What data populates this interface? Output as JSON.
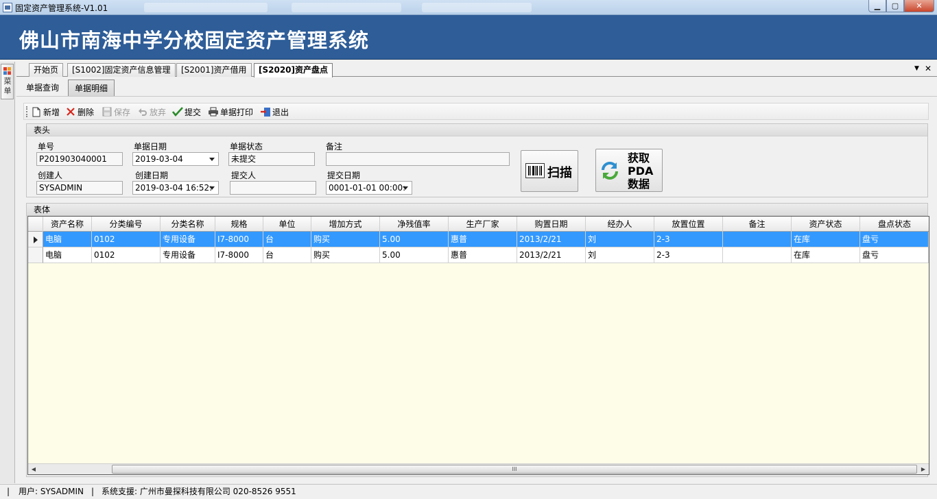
{
  "window": {
    "title": "固定资产管理系统-V1.01",
    "controls": {
      "minimize": "▁",
      "maximize": "▢",
      "close": "✕"
    }
  },
  "banner": {
    "title": "佛山市南海中学分校固定资产管理系统"
  },
  "left_menu": {
    "label": "菜单",
    "icon": "menu-grid-icon"
  },
  "doc_tabs": [
    {
      "label": "开始页"
    },
    {
      "label": "[S1002]固定资产信息管理"
    },
    {
      "label": "[S2001]资产借用"
    },
    {
      "label": "[S2020]资产盘点",
      "active": true
    }
  ],
  "tab_controls": {
    "dropdown": "▼",
    "close": "✕"
  },
  "sub_tabs": [
    {
      "label": "单据查询"
    },
    {
      "label": "单据明细",
      "active": true
    }
  ],
  "toolbar": {
    "new": "新增",
    "delete": "删除",
    "save": "保存",
    "discard": "放弃",
    "submit": "提交",
    "print": "单据打印",
    "exit": "退出"
  },
  "header_section": {
    "title": "表头",
    "doc_no_label": "单号",
    "doc_no": "P201903040001",
    "doc_date_label": "单据日期",
    "doc_date": "2019-03-04",
    "doc_status_label": "单据状态",
    "doc_status": "未提交",
    "remark_label": "备注",
    "remark": "",
    "creator_label": "创建人",
    "creator": "SYSADMIN",
    "create_date_label": "创建日期",
    "create_date": "2019-03-04 16:52:",
    "submitter_label": "提交人",
    "submitter": "",
    "submit_date_label": "提交日期",
    "submit_date": "0001-01-01 00:00:",
    "scan_button": "扫描",
    "pda_button_line1": "获取",
    "pda_button_line2": "PDA",
    "pda_button_line3": "数据"
  },
  "body_section": {
    "title": "表体",
    "columns": [
      "资产名称",
      "分类编号",
      "分类名称",
      "规格",
      "单位",
      "增加方式",
      "净残值率",
      "生产厂家",
      "购置日期",
      "经办人",
      "放置位置",
      "备注",
      "资产状态",
      "盘点状态"
    ],
    "rows": [
      [
        "电脑",
        "0102",
        "专用设备",
        "I7-8000",
        "台",
        "购买",
        "5.00",
        "惠普",
        "2013/2/21",
        "刘",
        "2-3",
        "",
        "在库",
        "盘亏"
      ],
      [
        "电脑",
        "0102",
        "专用设备",
        "I7-8000",
        "台",
        "购买",
        "5.00",
        "惠普",
        "2013/2/21",
        "刘",
        "2-3",
        "",
        "在库",
        "盘亏"
      ]
    ],
    "selected_row": 0,
    "scroll": {
      "left": "◀",
      "right": "▶",
      "thumb": "III"
    }
  },
  "status_bar": {
    "user": "用户: SYSADMIN",
    "sep": "|",
    "support": "系统支援: 广州市曼探科技有限公司 020-8526 9551"
  },
  "colors": {
    "banner": "#2e5d98",
    "selected_row": "#3399ff",
    "grid_bg": "#fdfde8"
  }
}
